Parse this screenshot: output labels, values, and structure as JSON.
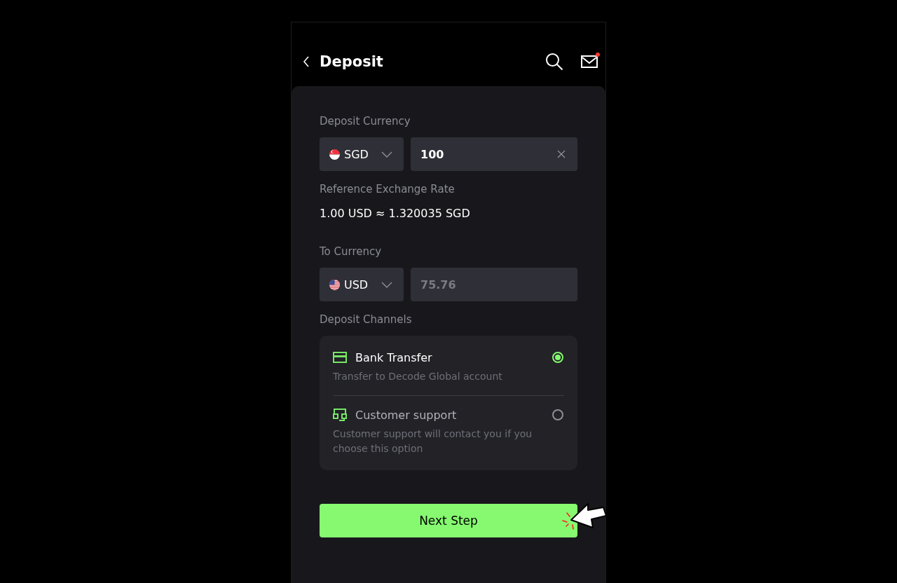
{
  "header": {
    "title": "Deposit",
    "unread": true
  },
  "deposit_currency": {
    "label": "Deposit Currency",
    "currency": "SGD",
    "amount": "100",
    "disabled": false
  },
  "exchange_rate": {
    "label": "Reference Exchange Rate",
    "value": "1.00 USD ≈ 1.320035 SGD"
  },
  "to_currency": {
    "label": "To Currency",
    "currency": "USD",
    "amount": "75.76",
    "disabled": true
  },
  "deposit_channels": {
    "label": "Deposit Channels",
    "items": [
      {
        "kind": "bank",
        "title": "Bank Transfer",
        "description": "Transfer to Decode Global account",
        "selected": true
      },
      {
        "kind": "support",
        "title": "Customer support",
        "description": "Customer support will contact you if you choose this option",
        "selected": false
      }
    ]
  },
  "next_button": {
    "label": "Next Step"
  }
}
